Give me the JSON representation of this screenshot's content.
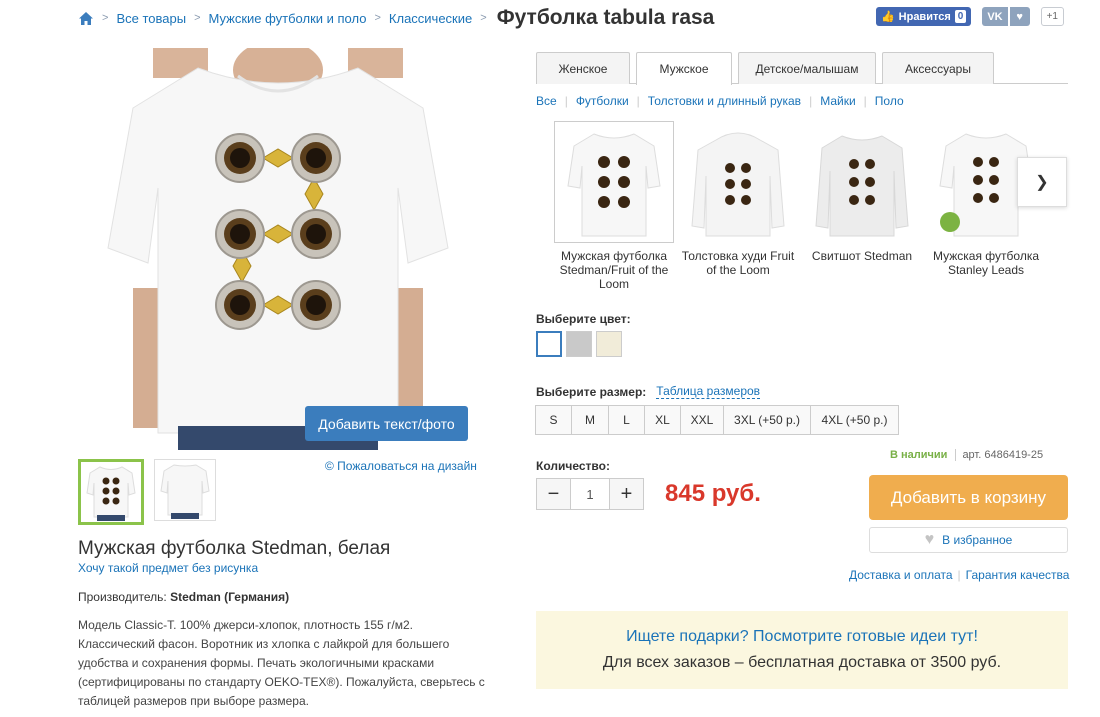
{
  "breadcrumb": {
    "items": [
      "Все товары",
      "Мужские футболки и поло",
      "Классические"
    ],
    "title": "Футболка tabula rasa"
  },
  "social": {
    "fb_like": "Нравится",
    "fb_count": "0",
    "vk_label": "VK",
    "plus_one": "+1"
  },
  "product": {
    "add_text_button": "Добавить текст/фото",
    "report_link": "© Пожаловаться на дизайн",
    "title": "Мужская футболка Stedman, белая",
    "no_print_link": "Хочу такой предмет без рисунка",
    "maker_label": "Производитель:",
    "maker_value": "Stedman (Германия)",
    "description": "Модель Classic-T. 100% джерси-хлопок, плотность 155 г/м2. Классический фасон. Воротник из хлопка с лайкрой для большего удобства и сохранения формы. Печать экологичными красками (сертифицированы по стандарту OEKO-TEX®). Пожалуйста, сверьтесь с таблицей размеров при выборе размера."
  },
  "tabs": [
    {
      "label": "Женское",
      "active": false
    },
    {
      "label": "Мужское",
      "active": true
    },
    {
      "label": "Детское/малышам",
      "active": false
    },
    {
      "label": "Аксессуары",
      "active": false
    }
  ],
  "subcategories": [
    "Все",
    "Футболки",
    "Толстовки и длинный рукав",
    "Майки",
    "Поло"
  ],
  "variants": [
    {
      "label": "Мужская футболка Stedman/Fruit of the Loom",
      "active": true
    },
    {
      "label": "Толстовка худи Fruit of the Loom",
      "active": false
    },
    {
      "label": "Свитшот Stedman",
      "active": false
    },
    {
      "label": "Мужская футболка Stanley Leads",
      "active": false
    }
  ],
  "color": {
    "label": "Выберите цвет:",
    "swatches": [
      "#ffffff",
      "#c9c9c9",
      "#f1ecd9"
    ]
  },
  "size": {
    "label": "Выберите размер:",
    "table_link": "Таблица размеров",
    "options": [
      "S",
      "M",
      "L",
      "XL",
      "XXL",
      "3XL (+50 р.)",
      "4XL (+50 р.)"
    ]
  },
  "quantity": {
    "label": "Количество:",
    "value": "1",
    "minus": "−",
    "plus": "+"
  },
  "price": "845 руб.",
  "stock": {
    "status": "В наличии",
    "article": "арт. 6486419-25"
  },
  "cart_button": "Добавить в корзину",
  "favorite_button": "В избранное",
  "links": {
    "delivery": "Доставка и оплата",
    "guarantee": "Гарантия качества"
  },
  "promo": {
    "line1": "Ищете подарки? Посмотрите готовые идеи тут!",
    "line2": "Для всех заказов – бесплатная доставка от 3500 руб."
  },
  "colors": {
    "accent_blue": "#1a73b8",
    "button_blue": "#3b7dbd",
    "cart_orange": "#f0ad4e",
    "price_red": "#d9382b",
    "stock_green": "#79b047"
  }
}
